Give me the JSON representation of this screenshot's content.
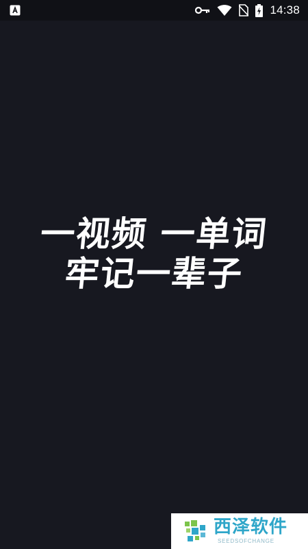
{
  "status_bar": {
    "time": "14:38",
    "icons": [
      "app-notification-icon",
      "vpn-key-icon",
      "wifi-icon",
      "no-sim-icon",
      "battery-charging-icon"
    ]
  },
  "splash": {
    "line1": "一视频 一单词",
    "line2": "牢记一辈子"
  },
  "watermark": {
    "title": "西泽软件",
    "subtitle": "SEEDSOFCHANGE",
    "colors": {
      "title": "#2ea6c9",
      "logo_green": "#7cc44b",
      "logo_blue": "#2ea6c9"
    }
  },
  "colors": {
    "background": "#171820",
    "status_bar": "#101116",
    "text": "#ffffff"
  }
}
